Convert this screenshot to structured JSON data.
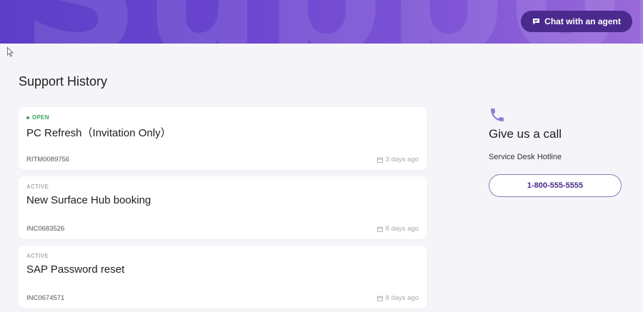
{
  "banner": {
    "decoration_text": "Support",
    "chat_button_label": "Chat with an agent",
    "chat_icon": "chat-bubble-icon"
  },
  "history": {
    "title": "Support History",
    "tickets": [
      {
        "status": "OPEN",
        "title": "PC Refresh（Invitation Only）",
        "id": "RITM0089756",
        "date": "3 days ago"
      },
      {
        "status": "ACTIVE",
        "title": "New Surface Hub booking",
        "id": "INC0683526",
        "date": "8 days ago"
      },
      {
        "status": "ACTIVE",
        "title": "SAP Password reset",
        "id": "INC0674571",
        "date": "8 days ago"
      }
    ]
  },
  "call": {
    "icon": "phone-icon",
    "title": "Give us a call",
    "hotline_label": "Service Desk Hotline",
    "phone_number": "1-800-555-5555"
  },
  "colors": {
    "brand_purple": "#4b2a8e",
    "banner_start": "#5b3fc8",
    "banner_end": "#9a6ad9",
    "open_green": "#3aa55d",
    "icon_lavender": "#8f7ad8"
  }
}
